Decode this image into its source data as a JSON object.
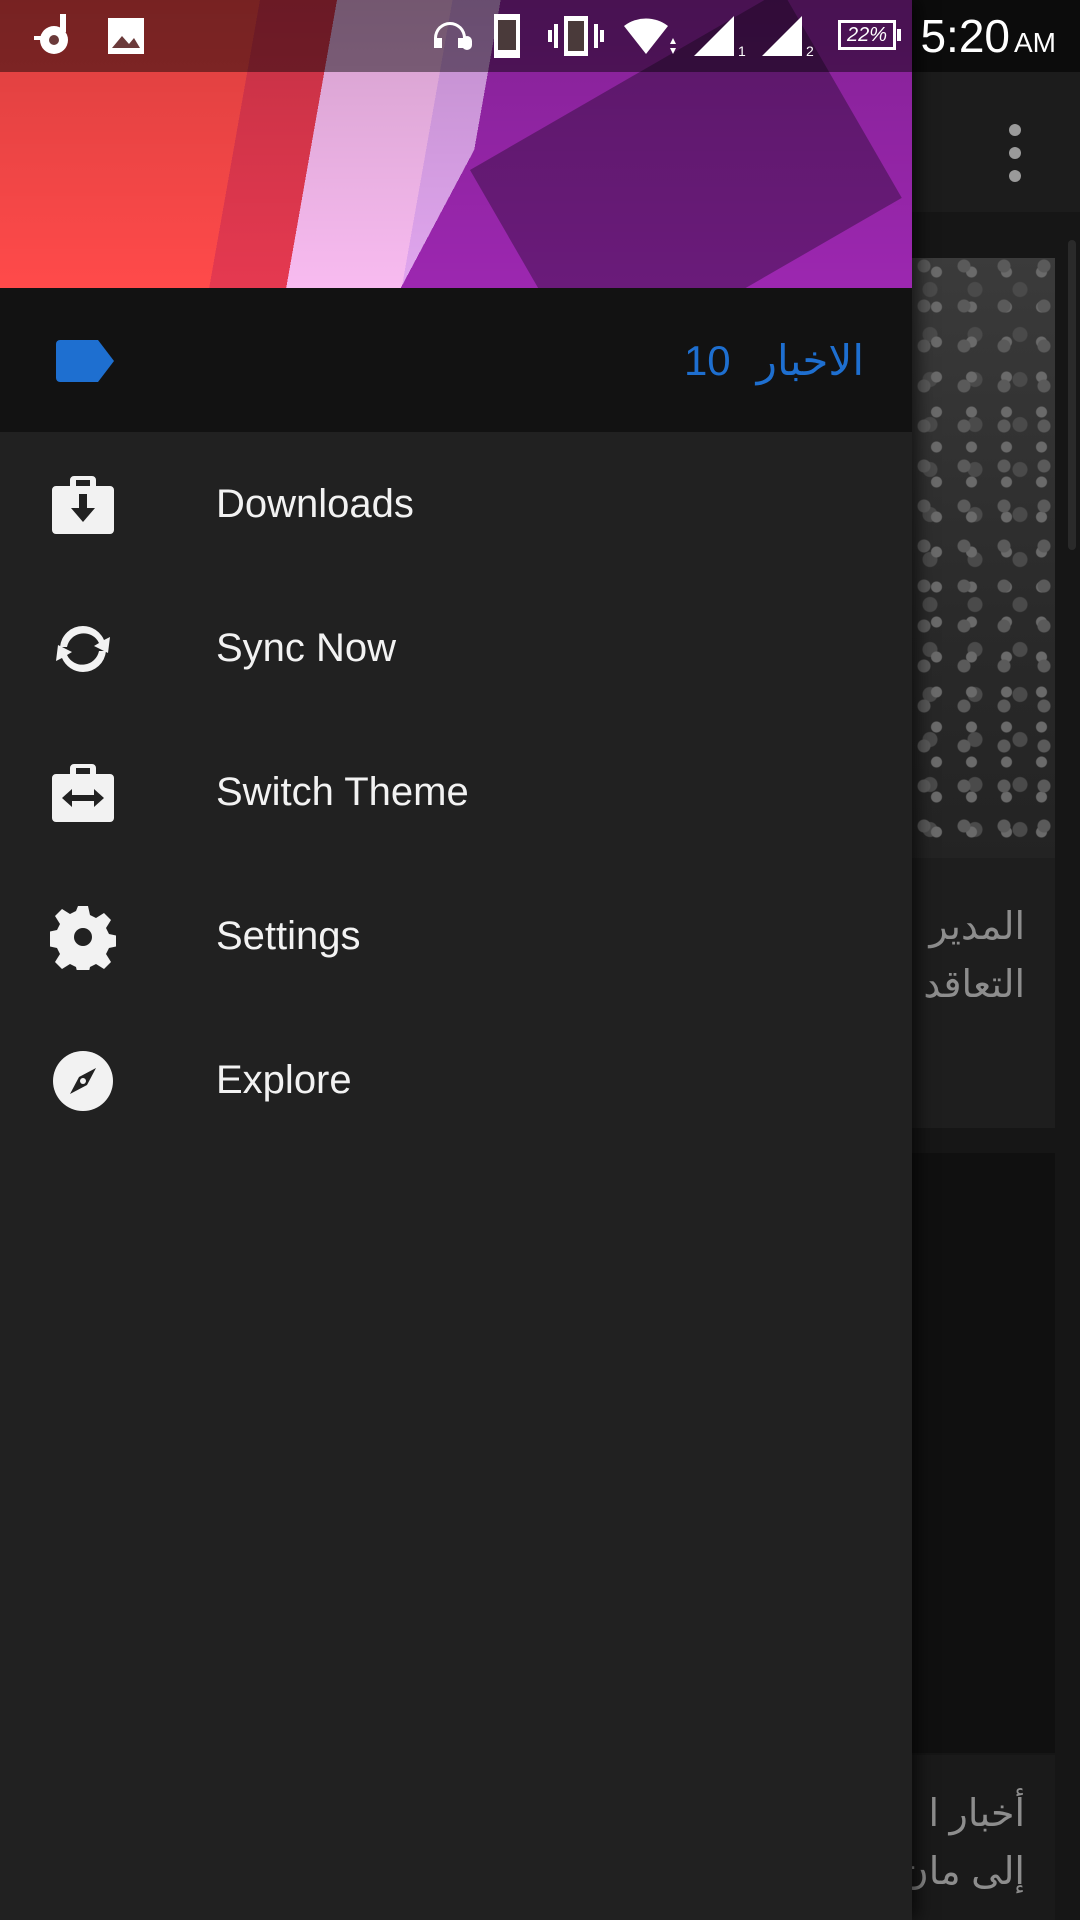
{
  "status_bar": {
    "battery": "22%",
    "time": "5:20",
    "ampm": "AM"
  },
  "drawer": {
    "account": {
      "label": "الاخبار",
      "count": "10"
    },
    "menu": [
      {
        "label": "Downloads",
        "icon": "download-bag-icon"
      },
      {
        "label": "Sync Now",
        "icon": "sync-icon"
      },
      {
        "label": "Switch Theme",
        "icon": "switch-theme-icon"
      },
      {
        "label": "Settings",
        "icon": "gear-icon"
      },
      {
        "label": "Explore",
        "icon": "compass-icon"
      }
    ]
  },
  "background": {
    "card1_line1": "المدير",
    "card1_line2": "التعاقد",
    "card3_line1": "أخبار ا",
    "card3_line2": "إلى مان"
  },
  "colors": {
    "accent": "#1e6fd0",
    "drawer_bg": "#212121",
    "account_bg": "#121212"
  }
}
